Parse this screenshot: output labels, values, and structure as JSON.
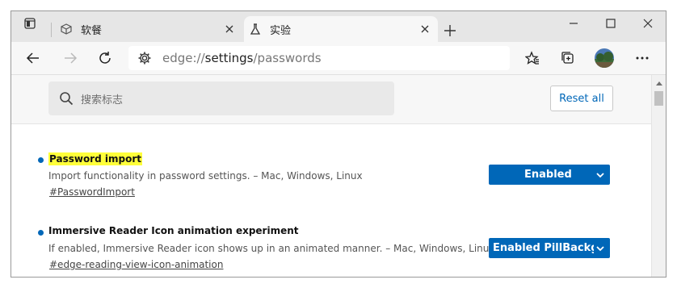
{
  "tabs": [
    {
      "title": "软餐",
      "icon": "box-icon",
      "active": false
    },
    {
      "title": "实验",
      "icon": "beaker-icon",
      "active": true
    }
  ],
  "address_bar": {
    "scheme": "edge://",
    "host": "settings",
    "path": "/passwords"
  },
  "search": {
    "placeholder": "搜索标志"
  },
  "reset_button": {
    "label": "Reset all"
  },
  "experiments": [
    {
      "name": "Password import",
      "highlighted": true,
      "description": "Import functionality in password settings. – Mac, Windows, Linux",
      "link": "#PasswordImport",
      "value": "Enabled"
    },
    {
      "name": "Immersive Reader Icon animation experiment",
      "highlighted": false,
      "description": "If enabled, Immersive Reader icon shows up in an animated manner. – Mac, Windows, Linux",
      "link": "#edge-reading-view-icon-animation",
      "value": "Enabled PillBackgrou"
    }
  ],
  "colors": {
    "accent": "#0067b8",
    "highlight": "#ffff3a"
  }
}
